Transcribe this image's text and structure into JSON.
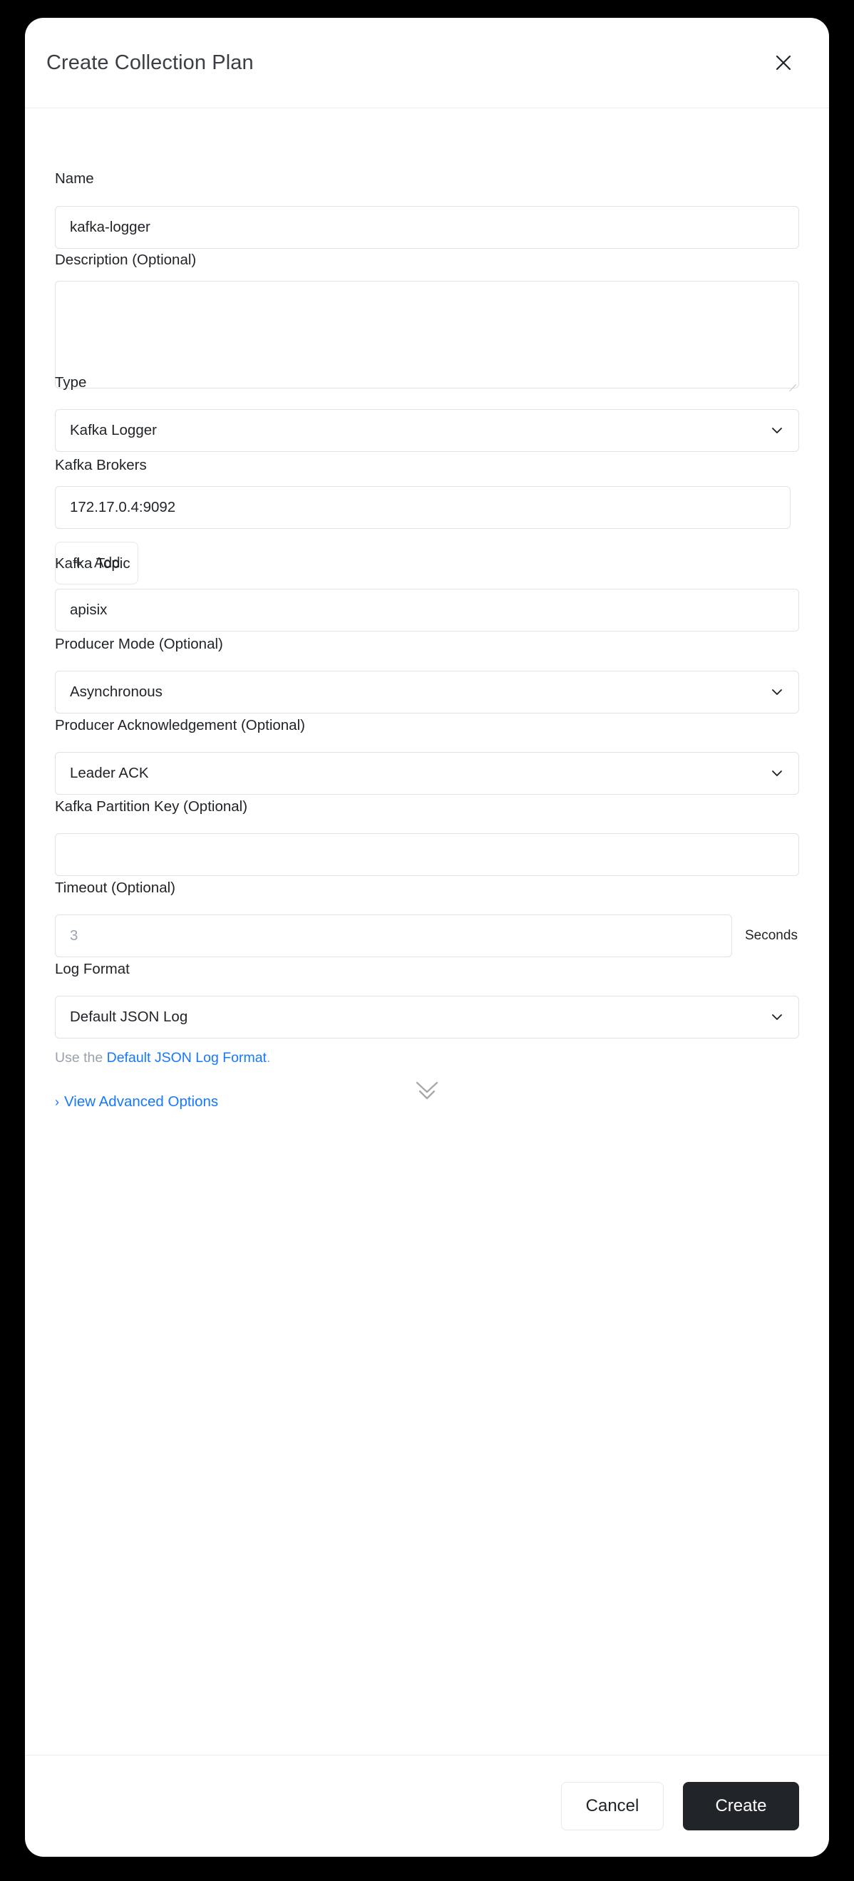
{
  "dialog": {
    "title": "Create Collection Plan",
    "close_icon": "close-icon"
  },
  "fields": {
    "name": {
      "label": "Name",
      "value": "kafka-logger",
      "placeholder": ""
    },
    "description": {
      "label": "Description (Optional)",
      "value": "",
      "placeholder": ""
    },
    "type": {
      "label": "Type",
      "value": "Kafka Logger",
      "chevron_icon": "chevron-down-icon"
    },
    "kafka_brokers": {
      "label": "Kafka Brokers",
      "value": "172.17.0.4:9092",
      "add_label": "Add",
      "add_icon": "plus-icon"
    },
    "kafka_topic": {
      "label": "Kafka Topic",
      "value": "apisix",
      "placeholder": ""
    },
    "producer_mode": {
      "label": "Producer Mode (Optional)",
      "value": "Asynchronous",
      "chevron_icon": "chevron-down-icon"
    },
    "producer_ack": {
      "label": "Producer Acknowledgement (Optional)",
      "value": "Leader ACK",
      "chevron_icon": "chevron-down-icon"
    },
    "partition_key": {
      "label": "Kafka Partition Key (Optional)",
      "value": "",
      "placeholder": ""
    },
    "timeout": {
      "label": "Timeout (Optional)",
      "value": "",
      "placeholder": "3",
      "unit": "Seconds"
    },
    "log_format": {
      "label": "Log Format",
      "value": "Default JSON Log",
      "chevron_icon": "chevron-down-icon",
      "hint_prefix": "Use the ",
      "hint_link": "Default JSON Log Format",
      "hint_suffix": "."
    }
  },
  "advanced": {
    "caret": "›",
    "label": "View Advanced Options"
  },
  "scroll_hint": {
    "icon": "double-chevron-down-icon"
  },
  "footer": {
    "cancel_label": "Cancel",
    "create_label": "Create"
  },
  "colors": {
    "accent_link": "#1677ff",
    "primary_button_bg": "#212529",
    "border": "#dde3ec",
    "backdrop": "#000000"
  }
}
